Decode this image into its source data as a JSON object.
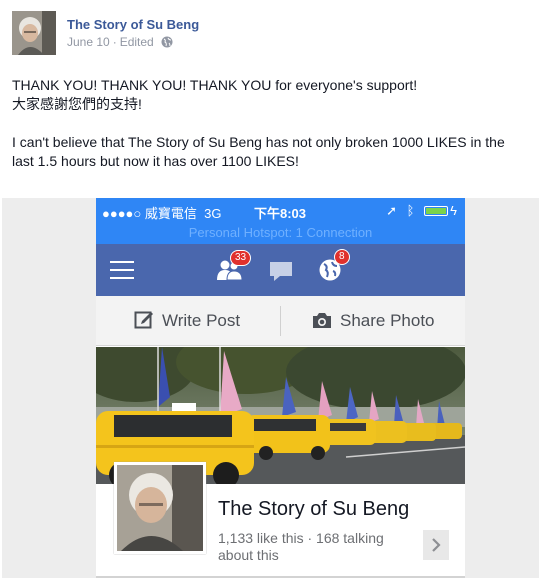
{
  "post": {
    "page_name": "The Story of Su Beng",
    "date": "June 10",
    "separator": "·",
    "edited": "Edited",
    "privacy_icon": "globe-icon",
    "text_line1": "THANK YOU! THANK YOU! THANK YOU for everyone's support!",
    "text_line2": "大家感謝您們的支持!",
    "text_line3": "I can't believe that The Story of Su Beng has not only broken 1000 LIKES in the",
    "text_line4": "last 1.5 hours but now it has over 1100 LIKES!"
  },
  "phone": {
    "statusbar": {
      "carrier": "●●●●○ 威寶電信",
      "network": "3G",
      "time": "下午8:03",
      "icons": [
        "location-arrow-icon",
        "bluetooth-icon",
        "battery-icon"
      ]
    },
    "hotspot_text": "Personal Hotspot: 1 Connection",
    "navbar": {
      "friends_badge": "33",
      "notifications_badge": "8"
    },
    "actions": {
      "write_post": "Write Post",
      "share_photo": "Share Photo"
    },
    "page": {
      "name": "The Story of Su Beng",
      "stats": "1,133 like this · 168 talking about this"
    }
  },
  "colors": {
    "link_blue": "#3b5998",
    "ios_statusbar": "#2f86f5",
    "fb_navbar": "#4a67ad",
    "badge_red": "#e0312d",
    "taxi_yellow": "#f2c21a"
  }
}
